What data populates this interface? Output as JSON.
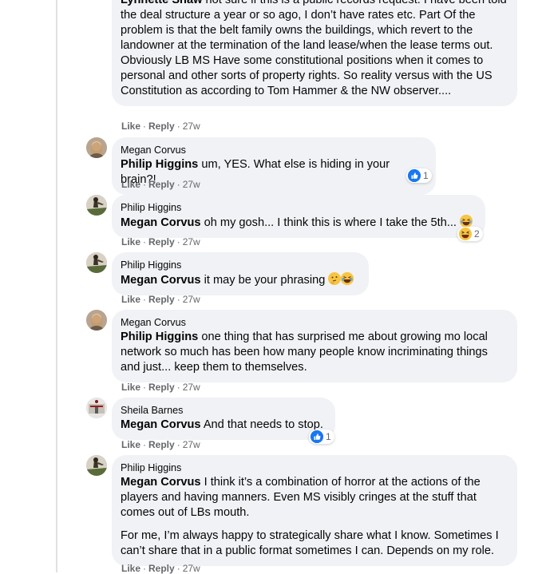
{
  "comments": [
    {
      "author": "Lynnette Shaw",
      "mention": "",
      "text": "not sure if this is a public records request. I have been told the deal structure a year or so ago, I don’t have rates etc. Part Of the problem is that the belt family owns the buildings, which revert to the landowner at the termination of the land lease/when the lease terms out. Obviously LB MS Have some constitutional positions when it comes to personal and other sorts of property rights. So reality versus with the US Constitution as according to Tom Hammer & the NW observer....",
      "like": "Like",
      "reply": "Reply",
      "time": "27w"
    },
    {
      "author": "Megan Corvus",
      "mention": "Philip Higgins",
      "text": "um, YES. What else is hiding in your brain?!",
      "like": "Like",
      "reply": "Reply",
      "time": "27w",
      "reaction_count": "1",
      "reaction_icon": "like-icon"
    },
    {
      "author": "Philip Higgins",
      "mention": "Megan Corvus",
      "text": "oh my gosh... I think this is where I take the 5th...",
      "like": "Like",
      "reply": "Reply",
      "time": "27w",
      "reaction_count": "2",
      "reaction_icon": "haha-icon"
    },
    {
      "author": "Philip Higgins",
      "mention": "Megan Corvus",
      "text": "it may be your phrasing",
      "like": "Like",
      "reply": "Reply",
      "time": "27w"
    },
    {
      "author": "Megan Corvus",
      "mention": "Philip Higgins",
      "text": "one thing that has surprised me about growing mo local network so much has been how many people know incriminating things and just... keep them to themselves.",
      "like": "Like",
      "reply": "Reply",
      "time": "27w"
    },
    {
      "author": "Sheila Barnes",
      "mention": "Megan Corvus",
      "text": "And that needs to stop.",
      "like": "Like",
      "reply": "Reply",
      "time": "27w",
      "reaction_count": "1",
      "reaction_icon": "like-icon"
    },
    {
      "author": "Philip Higgins",
      "mention": "Megan Corvus",
      "text": "I think it’s a combination of horror at the actions of the players and having manners. Even MS visibly cringes at the stuff that comes out of LBs mouth.",
      "text2": "For me, I’m always happy to strategically share what I know. Sometimes I can’t share that in a public format sometimes I can. Depends on my role.",
      "like": "Like",
      "reply": "Reply",
      "time": "27w"
    }
  ],
  "colors": {
    "bubble": "#f0f2f5",
    "meta": "#65676b",
    "like_blue": "#1877f2",
    "emoji_yellow": "#f7c543"
  }
}
